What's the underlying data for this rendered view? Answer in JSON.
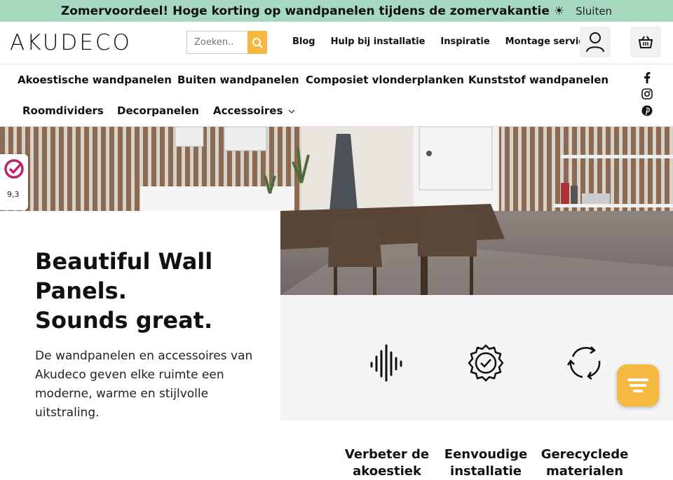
{
  "promo": {
    "message": "Zomervoordeel! Hoge korting op wandpanelen tijdens de zomervakantie ☀",
    "close": "Sluiten"
  },
  "header": {
    "logo": "AKUDECO",
    "search_placeholder": "Zoeken..",
    "nav": [
      "Blog",
      "Hulp bij installatie",
      "Inspiratie",
      "Montage service"
    ]
  },
  "categories": {
    "row1": [
      "Akoestische wandpanelen",
      "Buiten wandpanelen",
      "Composiet vlonderplanken",
      "Kunststof wandpanelen"
    ],
    "row2": [
      "Roomdividers",
      "Decorpanelen",
      "Accessoires"
    ]
  },
  "rating": {
    "score": "9,3"
  },
  "hero": {
    "title_lines": [
      "Beautiful Wall",
      "Panels.",
      "Sounds great."
    ],
    "text": "De wandpanelen en accessoires van Akudeco geven elke ruimte een moderne, warme en stijlvolle uitstraling."
  },
  "features": [
    {
      "label": "Verbeter de akoestiek",
      "icon": "soundwave-icon"
    },
    {
      "label": "Eenvoudige installatie",
      "icon": "check-gear-icon"
    },
    {
      "label": "Gerecyclede materialen",
      "icon": "recycle-icon"
    }
  ],
  "colors": {
    "promo_bg": "#a7d9c1",
    "accent": "#f5b841"
  }
}
